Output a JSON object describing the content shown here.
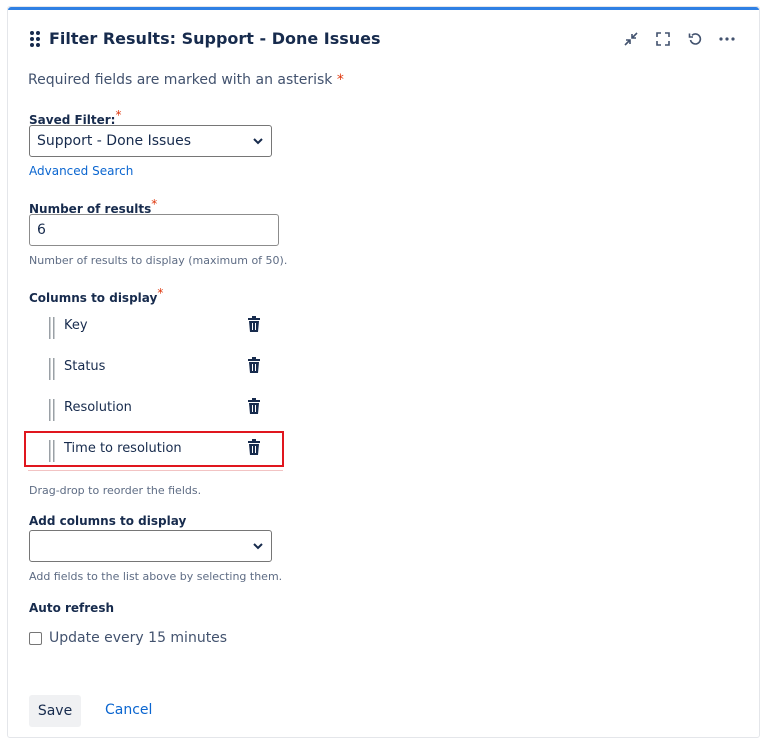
{
  "header": {
    "title": "Filter Results: Support - Done Issues",
    "icons": [
      "drag-handle-icon",
      "minimize-icon",
      "fullscreen-icon",
      "refresh-icon",
      "more-icon"
    ]
  },
  "form": {
    "required_note": "Required fields are marked with an asterisk",
    "required_star": "*",
    "saved_filter": {
      "label": "Saved Filter:",
      "value": "Support - Done Issues",
      "link": "Advanced Search"
    },
    "num_results": {
      "label": "Number of results",
      "value": "6",
      "help": "Number of results to display (maximum of 50)."
    },
    "columns": {
      "label": "Columns to display",
      "items": [
        {
          "name": "Key"
        },
        {
          "name": "Status"
        },
        {
          "name": "Resolution"
        },
        {
          "name": "Time to resolution"
        }
      ],
      "help": "Drag-drop to reorder the fields."
    },
    "add_columns": {
      "label": "Add columns to display",
      "value": "",
      "help": "Add fields to the list above by selecting them."
    },
    "auto_refresh": {
      "label": "Auto refresh",
      "checkbox_label": "Update every 15 minutes",
      "checked": false
    }
  },
  "actions": {
    "save": "Save",
    "cancel": "Cancel"
  },
  "colors": {
    "accent_bar": "#2f80e4",
    "link": "#0b66d0",
    "required": "#de350b",
    "highlight_border": "#e0161e"
  }
}
